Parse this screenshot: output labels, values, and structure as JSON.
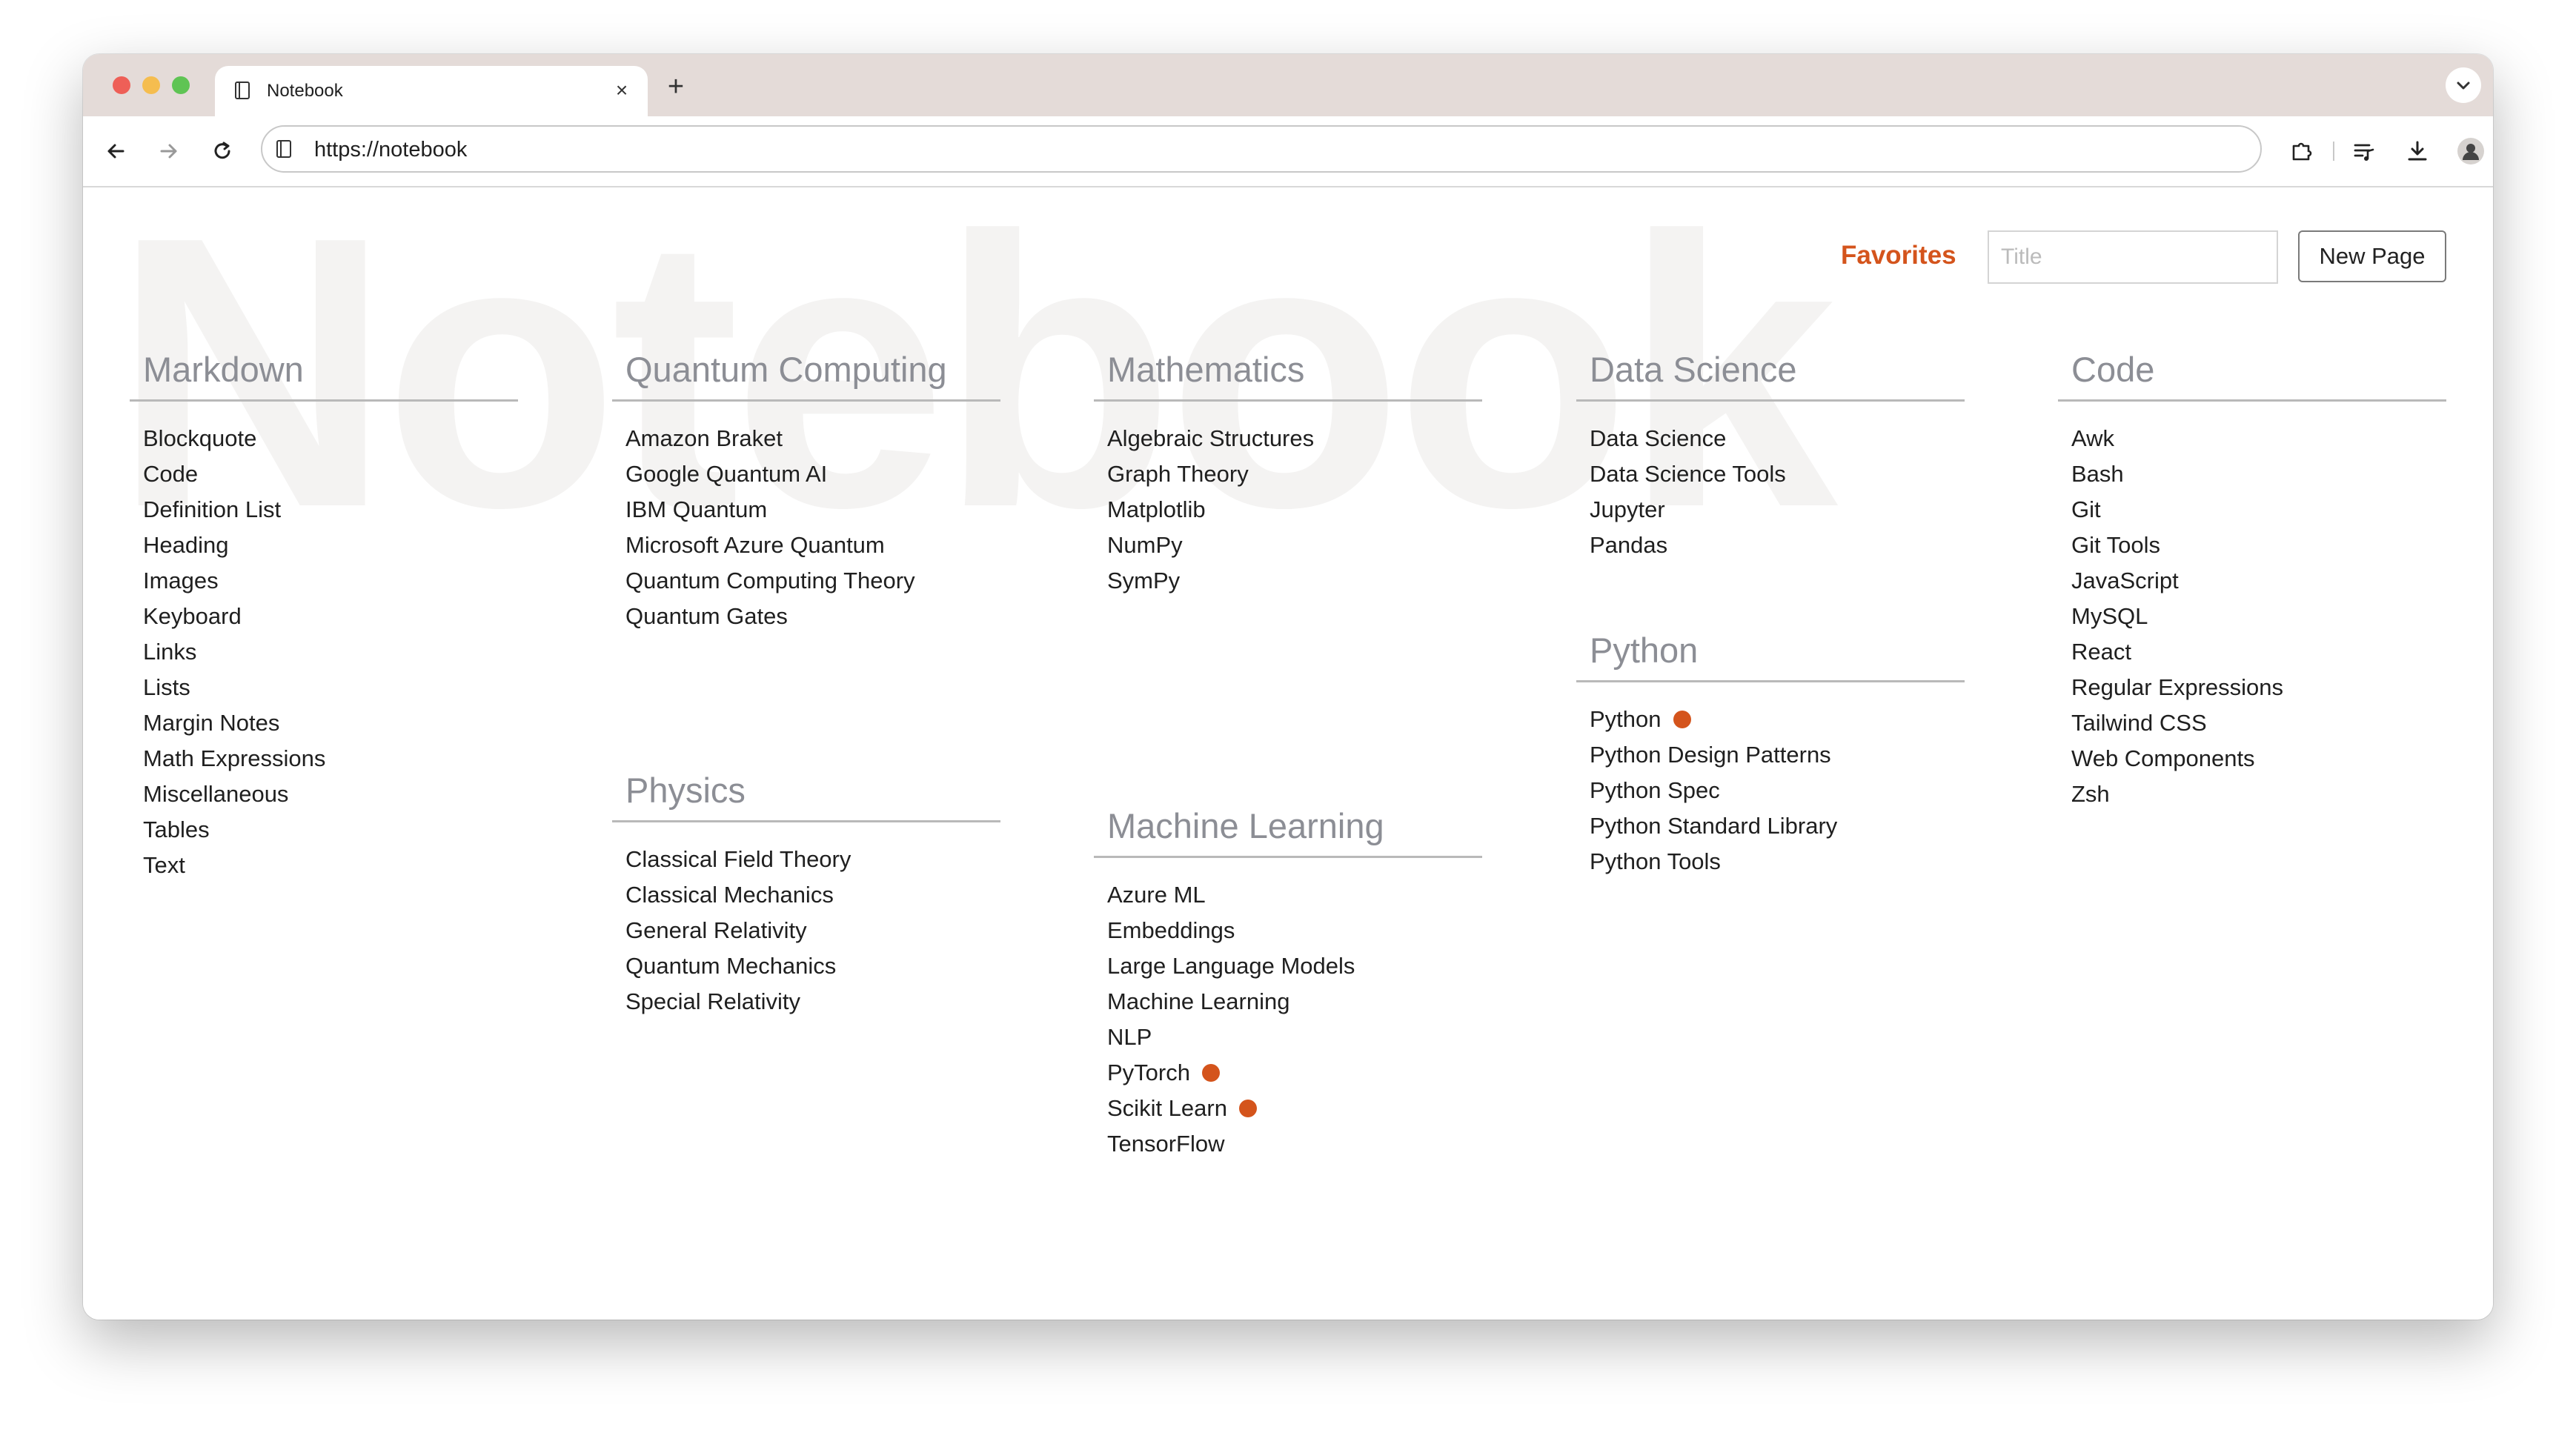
{
  "browser": {
    "tab_title": "Notebook",
    "url": "https://notebook"
  },
  "page": {
    "watermark": "Notebook",
    "favorites_label": "Favorites",
    "title_placeholder": "Title",
    "new_page_label": "New Page",
    "accent_color": "#d4541c"
  },
  "sections": [
    {
      "title": "Markdown",
      "items": [
        {
          "label": "Blockquote"
        },
        {
          "label": "Code"
        },
        {
          "label": "Definition List"
        },
        {
          "label": "Heading"
        },
        {
          "label": "Images"
        },
        {
          "label": "Keyboard"
        },
        {
          "label": "Links"
        },
        {
          "label": "Lists"
        },
        {
          "label": "Margin Notes"
        },
        {
          "label": "Math Expressions"
        },
        {
          "label": "Miscellaneous"
        },
        {
          "label": "Tables"
        },
        {
          "label": "Text"
        }
      ]
    },
    {
      "title": "Quantum Computing",
      "items": [
        {
          "label": "Amazon Braket"
        },
        {
          "label": "Google Quantum AI"
        },
        {
          "label": "IBM Quantum"
        },
        {
          "label": "Microsoft Azure Quantum"
        },
        {
          "label": "Quantum Computing Theory"
        },
        {
          "label": "Quantum Gates"
        }
      ]
    },
    {
      "title": "Physics",
      "items": [
        {
          "label": "Classical Field Theory"
        },
        {
          "label": "Classical Mechanics"
        },
        {
          "label": "General Relativity"
        },
        {
          "label": "Quantum Mechanics"
        },
        {
          "label": "Special Relativity"
        }
      ]
    },
    {
      "title": "Mathematics",
      "items": [
        {
          "label": "Algebraic Structures"
        },
        {
          "label": "Graph Theory"
        },
        {
          "label": "Matplotlib"
        },
        {
          "label": "NumPy"
        },
        {
          "label": "SymPy"
        }
      ]
    },
    {
      "title": "Machine Learning",
      "items": [
        {
          "label": "Azure ML"
        },
        {
          "label": "Embeddings"
        },
        {
          "label": "Large Language Models"
        },
        {
          "label": "Machine Learning"
        },
        {
          "label": "NLP"
        },
        {
          "label": "PyTorch",
          "favorite": true
        },
        {
          "label": "Scikit Learn",
          "favorite": true
        },
        {
          "label": "TensorFlow"
        }
      ]
    },
    {
      "title": "Data Science",
      "items": [
        {
          "label": "Data Science"
        },
        {
          "label": "Data Science Tools"
        },
        {
          "label": "Jupyter"
        },
        {
          "label": "Pandas"
        }
      ]
    },
    {
      "title": "Python",
      "items": [
        {
          "label": "Python",
          "favorite": true
        },
        {
          "label": "Python Design Patterns"
        },
        {
          "label": "Python Spec"
        },
        {
          "label": "Python Standard Library"
        },
        {
          "label": "Python Tools"
        }
      ]
    },
    {
      "title": "Code",
      "items": [
        {
          "label": "Awk"
        },
        {
          "label": "Bash"
        },
        {
          "label": "Git"
        },
        {
          "label": "Git Tools"
        },
        {
          "label": "JavaScript"
        },
        {
          "label": "MySQL"
        },
        {
          "label": "React"
        },
        {
          "label": "Regular Expressions"
        },
        {
          "label": "Tailwind CSS"
        },
        {
          "label": "Web Components"
        },
        {
          "label": "Zsh"
        }
      ]
    }
  ]
}
